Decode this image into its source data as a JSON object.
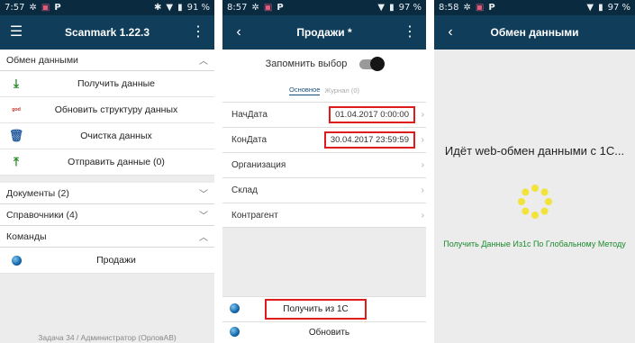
{
  "screen1": {
    "status": {
      "time": "7:57",
      "battery": "91 %"
    },
    "appbar": {
      "title": "Scanmark 1.22.3"
    },
    "section_exchange": {
      "label": "Обмен данными"
    },
    "actions": [
      {
        "label": "Получить данные",
        "icon": "download-icon"
      },
      {
        "label": "Обновить структуру данных",
        "icon": "structure-icon"
      },
      {
        "label": "Очистка данных",
        "icon": "trash-icon"
      },
      {
        "label": "Отправить данные (0)",
        "icon": "upload-icon"
      }
    ],
    "section_documents": {
      "label": "Документы (2)"
    },
    "section_directories": {
      "label": "Справочники (4)"
    },
    "section_commands": {
      "label": "Команды"
    },
    "command_sales": {
      "label": "Продажи"
    },
    "footer": "Задача 34 / Администратор (ОрловАВ)"
  },
  "screen2": {
    "status": {
      "time": "8:57",
      "battery": "97 %"
    },
    "appbar": {
      "title": "Продажи *"
    },
    "remember_label": "Запомнить выбор",
    "tab_main": "Основное",
    "tab_journal": "Журнал (0)",
    "fields": [
      {
        "label": "НачДата",
        "value": "01.04.2017 0:00:00"
      },
      {
        "label": "КонДата",
        "value": "30.04.2017 23:59:59"
      },
      {
        "label": "Организация",
        "value": ""
      },
      {
        "label": "Склад",
        "value": ""
      },
      {
        "label": "Контрагент",
        "value": ""
      }
    ],
    "get_button": "Получить из 1С",
    "refresh_button": "Обновить"
  },
  "screen3": {
    "status": {
      "time": "8:58",
      "battery": "97 %"
    },
    "appbar": {
      "title": "Обмен данными"
    },
    "message": "Идёт web-обмен данными с 1С...",
    "submessage": "Получить Данные Из1с По Глобальному Методу"
  },
  "colors": {
    "appbar": "#0f3d5a",
    "statusbar": "#0a2a3f",
    "highlight": "#e01b1b",
    "green_text": "#1c8a2e",
    "spinner": "#f2e23a"
  }
}
